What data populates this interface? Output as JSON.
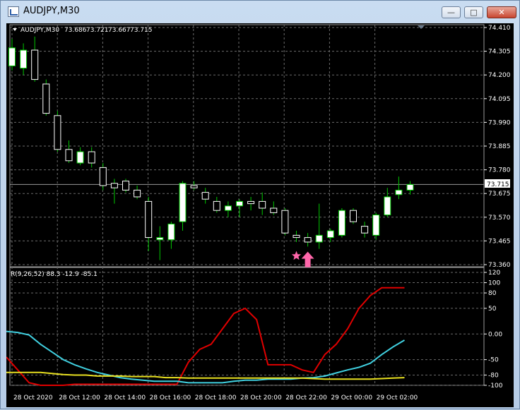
{
  "window": {
    "title": "AUDJPY,M30",
    "minimize_glyph": "—",
    "maximize_glyph": "□",
    "close_glyph": "✕"
  },
  "chart_header": {
    "symbol_tf": "AUDJPY,M30",
    "open": "73.686",
    "high": "73.721",
    "low": "73.667",
    "close": "73.715"
  },
  "current_price_label": "73.715",
  "indicator": {
    "label": "R(9,26,52) 88.3 -12.9 -85.1"
  },
  "colors": {
    "background": "#000000",
    "grid": "#6b6b6b",
    "bull_candle": "#ffffff",
    "wick": "#00c800",
    "star_marker": "#ff66aa",
    "arrow_marker": "#ff66aa",
    "line_fast": "#e00000",
    "line_mid": "#40d0e0",
    "line_slow": "#e8e020"
  },
  "icons": {
    "star": "star-icon",
    "arrow": "up-arrow-icon"
  },
  "chart_data": [
    {
      "type": "candlestick",
      "title": "AUDJPY,M30",
      "yaxis_ticks": [
        "74.410",
        "74.305",
        "74.200",
        "74.095",
        "73.990",
        "73.885",
        "73.780",
        "73.675",
        "73.570",
        "73.465",
        "73.360"
      ],
      "ylim": [
        73.36,
        74.41
      ],
      "x_ticks": [
        "28 Oct 2020",
        "28 Oct 12:00",
        "28 Oct 14:00",
        "28 Oct 16:00",
        "28 Oct 18:00",
        "28 Oct 20:00",
        "28 Oct 22:00",
        "29 Oct 00:00",
        "29 Oct 02:00"
      ],
      "candles": [
        {
          "o": 74.24,
          "h": 74.36,
          "l": 74.22,
          "c": 74.32
        },
        {
          "o": 74.23,
          "h": 74.34,
          "l": 74.2,
          "c": 74.31
        },
        {
          "o": 74.31,
          "h": 74.37,
          "l": 74.17,
          "c": 74.18
        },
        {
          "o": 74.16,
          "h": 74.18,
          "l": 74.02,
          "c": 74.03
        },
        {
          "o": 74.02,
          "h": 74.04,
          "l": 73.86,
          "c": 73.87
        },
        {
          "o": 73.87,
          "h": 73.91,
          "l": 73.81,
          "c": 73.82
        },
        {
          "o": 73.81,
          "h": 73.88,
          "l": 73.8,
          "c": 73.86
        },
        {
          "o": 73.86,
          "h": 73.88,
          "l": 73.79,
          "c": 73.81
        },
        {
          "o": 73.79,
          "h": 73.81,
          "l": 73.69,
          "c": 73.71
        },
        {
          "o": 73.72,
          "h": 73.74,
          "l": 73.63,
          "c": 73.7
        },
        {
          "o": 73.73,
          "h": 73.74,
          "l": 73.68,
          "c": 73.69
        },
        {
          "o": 73.69,
          "h": 73.71,
          "l": 73.65,
          "c": 73.66
        },
        {
          "o": 73.64,
          "h": 73.66,
          "l": 73.42,
          "c": 73.48
        },
        {
          "o": 73.47,
          "h": 73.53,
          "l": 73.38,
          "c": 73.48
        },
        {
          "o": 73.47,
          "h": 73.55,
          "l": 73.43,
          "c": 73.54
        },
        {
          "o": 73.55,
          "h": 73.73,
          "l": 73.51,
          "c": 73.72
        },
        {
          "o": 73.71,
          "h": 73.73,
          "l": 73.69,
          "c": 73.7
        },
        {
          "o": 73.68,
          "h": 73.7,
          "l": 73.63,
          "c": 73.65
        },
        {
          "o": 73.64,
          "h": 73.66,
          "l": 73.59,
          "c": 73.6
        },
        {
          "o": 73.6,
          "h": 73.64,
          "l": 73.57,
          "c": 73.62
        },
        {
          "o": 73.62,
          "h": 73.65,
          "l": 73.57,
          "c": 73.64
        },
        {
          "o": 73.64,
          "h": 73.66,
          "l": 73.6,
          "c": 73.63
        },
        {
          "o": 73.64,
          "h": 73.68,
          "l": 73.58,
          "c": 73.61
        },
        {
          "o": 73.61,
          "h": 73.64,
          "l": 73.58,
          "c": 73.59
        },
        {
          "o": 73.6,
          "h": 73.61,
          "l": 73.49,
          "c": 73.5
        },
        {
          "o": 73.49,
          "h": 73.51,
          "l": 73.46,
          "c": 73.48
        },
        {
          "o": 73.48,
          "h": 73.5,
          "l": 73.44,
          "c": 73.46
        },
        {
          "o": 73.46,
          "h": 73.63,
          "l": 73.43,
          "c": 73.49
        },
        {
          "o": 73.48,
          "h": 73.52,
          "l": 73.46,
          "c": 73.51
        },
        {
          "o": 73.49,
          "h": 73.61,
          "l": 73.48,
          "c": 73.6
        },
        {
          "o": 73.6,
          "h": 73.61,
          "l": 73.54,
          "c": 73.55
        },
        {
          "o": 73.53,
          "h": 73.55,
          "l": 73.48,
          "c": 73.5
        },
        {
          "o": 73.49,
          "h": 73.59,
          "l": 73.47,
          "c": 73.58
        },
        {
          "o": 73.58,
          "h": 73.7,
          "l": 73.57,
          "c": 73.66
        },
        {
          "o": 73.67,
          "h": 73.75,
          "l": 73.65,
          "c": 73.69
        },
        {
          "o": 73.69,
          "h": 73.73,
          "l": 73.67,
          "c": 73.715
        }
      ],
      "markers": [
        {
          "type": "star",
          "index": 25,
          "price": 73.43
        },
        {
          "type": "arrow-up",
          "index": 26,
          "price": 73.43
        }
      ]
    },
    {
      "type": "line",
      "title": "R(9,26,52) 88.3 -12.9 -85.1",
      "yaxis_ticks": [
        "120",
        "100",
        "80",
        "50",
        "0.00",
        "-50",
        "-80",
        "-100"
      ],
      "ylim": [
        -100,
        120
      ],
      "series": [
        {
          "name": "88.3",
          "color": "#e00000",
          "values": [
            -45,
            -70,
            -95,
            -100,
            -100,
            -100,
            -98,
            -98,
            -98,
            -98,
            -98,
            -98,
            -98,
            -98,
            -98,
            -98,
            -55,
            -30,
            -20,
            10,
            40,
            50,
            28,
            -60,
            -60,
            -60,
            -70,
            -75,
            -40,
            -20,
            10,
            50,
            75,
            90,
            90,
            90
          ]
        },
        {
          "name": "-12.9",
          "color": "#40d0e0",
          "values": [
            5,
            3,
            -2,
            -20,
            -35,
            -50,
            -60,
            -68,
            -75,
            -80,
            -85,
            -88,
            -90,
            -92,
            -92,
            -92,
            -95,
            -95,
            -95,
            -95,
            -92,
            -90,
            -90,
            -88,
            -88,
            -88,
            -86,
            -85,
            -82,
            -76,
            -70,
            -65,
            -57,
            -40,
            -25,
            -12
          ]
        },
        {
          "name": "-85.1",
          "color": "#e8e020",
          "values": [
            -75,
            -75,
            -75,
            -75,
            -77,
            -79,
            -80,
            -80,
            -82,
            -82,
            -82,
            -83,
            -83,
            -83,
            -85,
            -85,
            -86,
            -86,
            -86,
            -86,
            -86,
            -86,
            -86,
            -86,
            -86,
            -86,
            -86,
            -87,
            -88,
            -88,
            -88,
            -88,
            -88,
            -87,
            -86,
            -85
          ]
        }
      ]
    }
  ]
}
